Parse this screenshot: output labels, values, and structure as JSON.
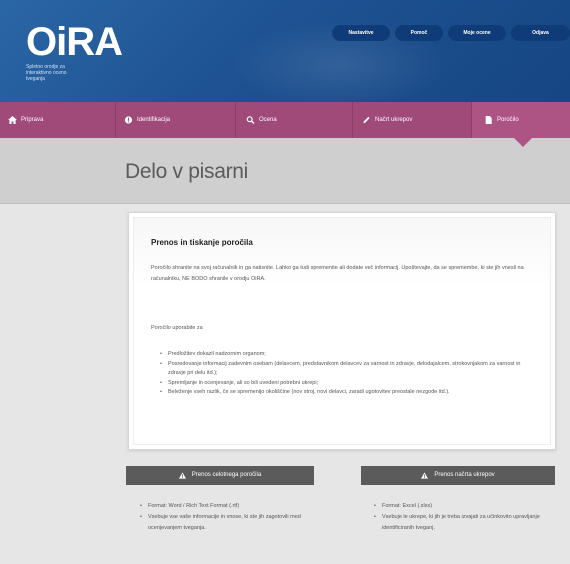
{
  "header": {
    "logo_text": "OiRA",
    "logo_subtitle": "Spletno orodje za interaktivno oceno tveganja",
    "top_links": [
      "Nastavitve",
      "Pomoč",
      "Moje ocene",
      "Odjava"
    ]
  },
  "nav": {
    "items": [
      {
        "label": "Priprava",
        "icon": "home-icon"
      },
      {
        "label": "Identifikacija",
        "icon": "alert-icon"
      },
      {
        "label": "Ocena",
        "icon": "search-icon"
      },
      {
        "label": "Načrt ukrepov",
        "icon": "pencil-icon"
      },
      {
        "label": "Poročilo",
        "icon": "document-icon"
      }
    ],
    "active": "Poročilo"
  },
  "page": {
    "title": "Delo v pisarni"
  },
  "panel": {
    "title": "Prenos in tiskanje poročila",
    "paragraph1": "Poročilo shranite na svoj računalnik in ga natisnite. Lahko ga tudi spremenite ali dodate več informacij. Upoštevajte, da se spremembe, ki ste jih vnesli na računalniku, NE BODO shranile v orodju OiRA.",
    "paragraph2": "Poročilo uporabite za",
    "bullets": [
      "Predložitev dokazil nadzornim organom;",
      "Posredovanje informacij zadevnim osebam (delavcem, predstavnikom delavcev za varnost in zdravje, delodajalcem, strokovnjakom za varnost in zdravje pri delu itd.);",
      "Spremljanje in ocenjevanje, ali so bili uvedeni potrebni ukrepi;",
      "Beleženje vseh razlik, če se spremenijo okoliščine (nov stroj, novi delavci, zaradi ugotovitev preostale nezgode itd.)."
    ]
  },
  "downloads": [
    {
      "label": "Prenos celotnega poročila",
      "icon": "warning-icon",
      "items": [
        "Format: Word / Rich Text Format (.rtf)",
        "Vsebuje vse vaše informacije in vnose, ki ste jih zagotovili med ocenjevanjem tveganja."
      ]
    },
    {
      "label": "Prenos načrta ukrepov",
      "icon": "warning-icon",
      "items": [
        "Format: Excel (.xlsx)",
        "Vsebuje le ukrepe, ki jih je treba izvajati za učinkovito upravljanje identificiranih tveganj."
      ]
    }
  ],
  "colors": {
    "header_blue": "#1e5292",
    "nav_purple": "#9f4a79",
    "button_gray": "#5b5b5b"
  }
}
